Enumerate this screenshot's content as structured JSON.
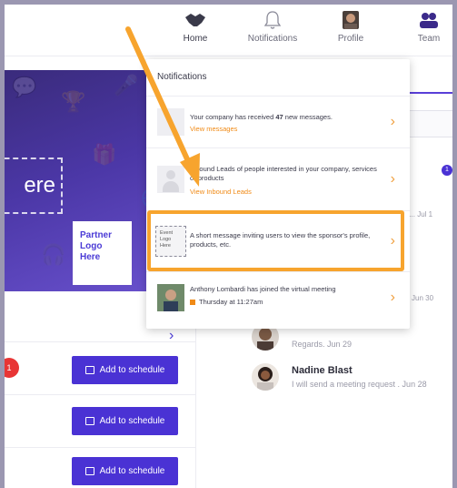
{
  "nav": {
    "home": {
      "label": "Home",
      "icon": "handshake-icon"
    },
    "notifications": {
      "label": "Notifications",
      "icon": "bell-icon"
    },
    "profile": {
      "label": "Profile",
      "icon": "profile-avatar"
    },
    "team": {
      "label": "Team",
      "icon": "team-icon"
    }
  },
  "banner": {
    "text_fragment": "ere",
    "partner_logo": "Partner\nLogo\nHere"
  },
  "schedule_buttons": [
    "Add to schedule",
    "Add to schedule",
    "Add to schedule"
  ],
  "badges": {
    "red_count": "1",
    "unread": "1"
  },
  "notifications": {
    "header": "Notifications",
    "items": [
      {
        "text_before": "Your company has received ",
        "count": "47",
        "text_after": " new messages.",
        "link": "View messages"
      },
      {
        "text": "Inbound Leads of people interested in your company, services or products",
        "link": "View Inbound Leads"
      },
      {
        "sponsor_logo": "Event\nLogo\nHere",
        "text": "A short message inviting users to view the sponsor's profile, products, etc."
      },
      {
        "text": "Anthony Lombardi has joined the virtual meeting",
        "time": "Thursday at 11:27am"
      }
    ]
  },
  "messages": {
    "snippet1": "K... Jul 1",
    "snippet2": "Jun 30",
    "items": [
      {
        "name": "",
        "text": "Regards. Jun 29"
      },
      {
        "name": "Nadine Blast",
        "text": "I will send a meeting request . Jun 28"
      }
    ]
  },
  "colors": {
    "accent": "#4a32d4",
    "highlight": "#f7a42e",
    "link": "#f08a16"
  }
}
